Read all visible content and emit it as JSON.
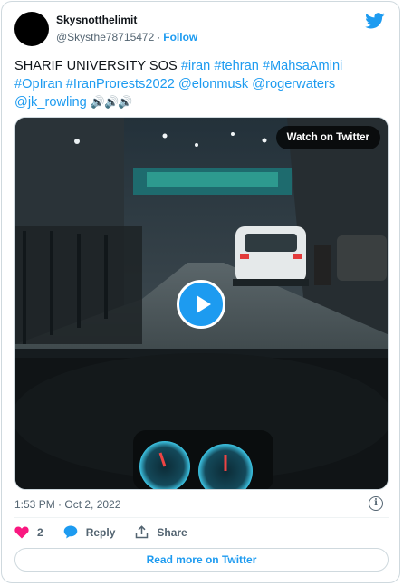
{
  "author": {
    "name": "Skysnotthelimit",
    "handle": "@Skysthe78715472",
    "follow_label": "Follow"
  },
  "tweet": {
    "parts": [
      {
        "text": "SHARIF UNIVERSITY SOS ",
        "type": "text"
      },
      {
        "text": "#iran",
        "type": "link"
      },
      {
        "text": " ",
        "type": "text"
      },
      {
        "text": "#tehran",
        "type": "link"
      },
      {
        "text": " ",
        "type": "text"
      },
      {
        "text": "#MahsaAmini",
        "type": "link"
      },
      {
        "text": " ",
        "type": "text"
      },
      {
        "text": "#OpIran",
        "type": "link"
      },
      {
        "text": " ",
        "type": "text"
      },
      {
        "text": "#IranProrests2022",
        "type": "link"
      },
      {
        "text": " ",
        "type": "text"
      },
      {
        "text": "@elonmusk",
        "type": "link"
      },
      {
        "text": " ",
        "type": "text"
      },
      {
        "text": "@rogerwaters",
        "type": "link"
      },
      {
        "text": " ",
        "type": "text"
      },
      {
        "text": "@jk_rowling",
        "type": "link"
      },
      {
        "text": " ",
        "type": "text"
      },
      {
        "text": "🔊🔊🔊",
        "type": "emoji"
      }
    ]
  },
  "media": {
    "watch_label": "Watch on Twitter"
  },
  "meta": {
    "timestamp": "1:53 PM · Oct 2, 2022"
  },
  "actions": {
    "like_count": "2",
    "reply_label": "Reply",
    "share_label": "Share"
  },
  "read_more_label": "Read more on Twitter",
  "colors": {
    "accent": "#1d9bf0",
    "like": "#f91880",
    "text": "#0f1419",
    "muted": "#536471"
  }
}
